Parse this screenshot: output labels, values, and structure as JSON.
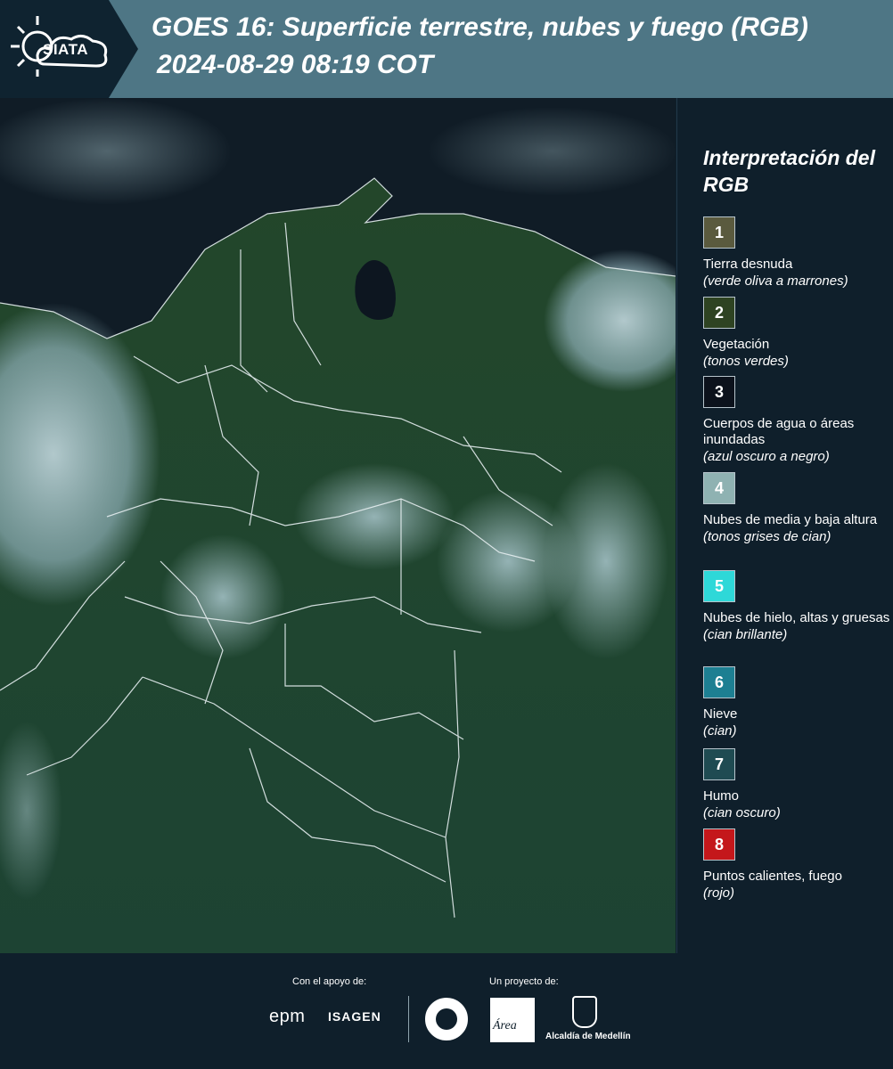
{
  "header": {
    "logo": "SIATA",
    "title_line1": "GOES 16: Superficie terrestre, nubes y fuego (RGB)",
    "title_line2": "2024-08-29 08:19 COT"
  },
  "legend": {
    "title": "Interpretación del RGB",
    "items": [
      {
        "num": "1",
        "label": "Tierra desnuda",
        "sub": "(verde oliva a marrones)",
        "color": "#5a5a3e"
      },
      {
        "num": "2",
        "label": "Vegetación",
        "sub": "(tonos verdes)",
        "color": "#2e4322"
      },
      {
        "num": "3",
        "label": "Cuerpos de agua o áreas inundadas",
        "sub": "(azul oscuro a negro)",
        "color": "#0c121c"
      },
      {
        "num": "4",
        "label": "Nubes de media y baja altura",
        "sub": "(tonos grises de cian)",
        "color": "#8fb2b2"
      },
      {
        "num": "5",
        "label": "Nubes de hielo, altas y gruesas",
        "sub": "(cian brillante)",
        "color": "#2ed8d8"
      },
      {
        "num": "6",
        "label": "Nieve",
        "sub": "(cian)",
        "color": "#1d7f92"
      },
      {
        "num": "7",
        "label": "Humo",
        "sub": "(cian oscuro)",
        "color": "#1f4b52"
      },
      {
        "num": "8",
        "label": "Puntos calientes, fuego",
        "sub": "(rojo)",
        "color": "#c4171b"
      }
    ]
  },
  "footer": {
    "support_label": "Con el apoyo de:",
    "project_label": "Un proyecto de:",
    "sponsor1": "epm",
    "sponsor2": "ISAGEN",
    "area_logo": "Área",
    "alcaldia": "Alcaldía de Medellín"
  }
}
